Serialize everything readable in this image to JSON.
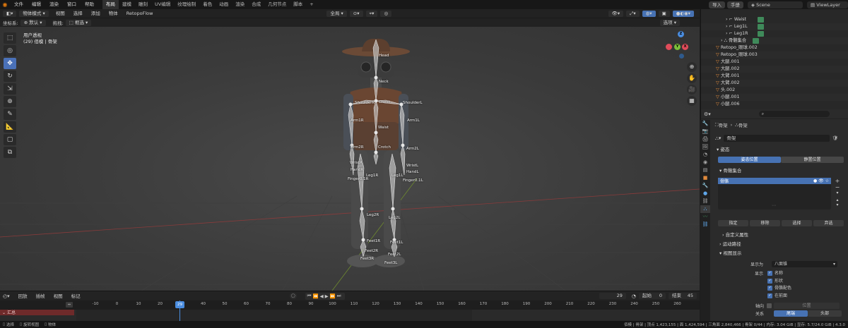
{
  "topbar": {
    "menus": [
      "文件",
      "编辑",
      "渲染",
      "窗口",
      "帮助"
    ],
    "workspaces": [
      "布局",
      "建模",
      "雕刻",
      "UV编辑",
      "纹理绘制",
      "着色",
      "动画",
      "渲染",
      "合成",
      "几何节点",
      "脚本"
    ],
    "active_workspace": "布局",
    "add_tab": "+",
    "import_label": "导入",
    "export_label": "手册",
    "scene_label": "Scene",
    "view_layer_label": "ViewLayer"
  },
  "header1": {
    "mode": "物体模式",
    "menus": [
      "视图",
      "选择",
      "添加",
      "物体",
      "RetopoFlow"
    ],
    "transform": "全局",
    "select_label": "选项"
  },
  "header2": {
    "coord_label": "坐标系:",
    "coord_value": "默认",
    "drag_label": "拖拽:",
    "drag_value": "框选"
  },
  "viewport": {
    "view_name": "用户透视",
    "object_info": "(29) 佰模 | 骨架",
    "bone_labels": [
      {
        "text": "Head"
      },
      {
        "text": "Neck"
      },
      {
        "text": "ShoulderR"
      },
      {
        "text": "Chest"
      },
      {
        "text": "ShoulderL"
      },
      {
        "text": "Arm1R"
      },
      {
        "text": "Waist"
      },
      {
        "text": "Arm1L"
      },
      {
        "text": "Arm2R"
      },
      {
        "text": "Crotch"
      },
      {
        "text": "Arm2L"
      },
      {
        "text": "WristR"
      },
      {
        "text": "WristL"
      },
      {
        "text": "HandR"
      },
      {
        "text": "HandL"
      },
      {
        "text": "Leg1R"
      },
      {
        "text": "Leg1L"
      },
      {
        "text": "Finger0.1R"
      },
      {
        "text": "Finger0.1L"
      },
      {
        "text": "Leg2R"
      },
      {
        "text": "Leg2L"
      },
      {
        "text": "Feet1R"
      },
      {
        "text": "Feet1L"
      },
      {
        "text": "Feet2R"
      },
      {
        "text": "Feet2L"
      },
      {
        "text": "Feet3R"
      },
      {
        "text": "Feet3L"
      }
    ],
    "gizmo": {
      "x": "X",
      "y": "Y",
      "z": "Z"
    }
  },
  "outliner": {
    "items": [
      {
        "label": "Waist",
        "type": "bone",
        "indent": 5
      },
      {
        "label": "Leg1L",
        "type": "bone",
        "indent": 5
      },
      {
        "label": "Leg1R",
        "type": "bone",
        "indent": 5
      },
      {
        "label": "骨骼集合",
        "type": "collection",
        "indent": 4
      },
      {
        "label": "Retopo_眼球.002",
        "type": "mesh",
        "indent": 3
      },
      {
        "label": "Retopo_眼球.003",
        "type": "mesh",
        "indent": 3
      },
      {
        "label": "大腿.001",
        "type": "mesh",
        "indent": 3
      },
      {
        "label": "大腿.002",
        "type": "mesh",
        "indent": 3
      },
      {
        "label": "大臂.001",
        "type": "mesh",
        "indent": 3
      },
      {
        "label": "大臂.002",
        "type": "mesh",
        "indent": 3
      },
      {
        "label": "头.002",
        "type": "mesh",
        "indent": 3
      },
      {
        "label": "小腿.001",
        "type": "mesh",
        "indent": 3
      },
      {
        "label": "小腿.006",
        "type": "mesh",
        "indent": 3
      }
    ]
  },
  "properties": {
    "breadcrumb_obj": "骨架",
    "breadcrumb_data": "骨架",
    "data_name": "骨架",
    "pose_panel": "姿态",
    "pose_position": "姿态位置",
    "rest_position": "静置位置",
    "bone_collections_panel": "骨骼集合",
    "collection_item": "骨骼",
    "assign": "指定",
    "remove": "移除",
    "select": "选择",
    "deselect": "弃选",
    "custom_props": "自定义属性",
    "motion_paths": "运动路径",
    "viewport_display": "视图显示",
    "display_as_label": "显示为",
    "display_as_value": "八面锥",
    "show_label": "显示",
    "show_names": "名称",
    "show_shapes": "形状",
    "show_colors": "骨骼配色",
    "show_infront": "在前面",
    "axes_label": "轴向",
    "axes_value": "位置",
    "relations_label": "关系",
    "relations_a": "尾端",
    "relations_b": "头部"
  },
  "timeline": {
    "menus": [
      "回放",
      "插帧",
      "视图",
      "标记"
    ],
    "current_frame": "29",
    "start_label": "起始",
    "start_value": "0",
    "end_label": "结束",
    "end_value": "45",
    "ruler": [
      "-10",
      "0",
      "10",
      "20",
      "29",
      "40",
      "50",
      "60",
      "70",
      "80",
      "90",
      "100",
      "110",
      "120",
      "130",
      "140",
      "150",
      "160",
      "170",
      "180",
      "190",
      "200",
      "210",
      "220",
      "230",
      "240",
      "250",
      "260"
    ],
    "track_label": "汇总"
  },
  "statusbar": {
    "select": "选择",
    "rotate": "旋转视图",
    "object": "物体",
    "stats": "佰模 | 骨架 | 顶点 1,423,155 | 面 1,424,594 | 三角面 2,840,466 | 骨架 0/44 | 内存: 3.04 GiB | 显存: 5.7/24.0 GiB | 4.3.0"
  },
  "colors": {
    "accent": "#4772b3",
    "collection_green": "#3f8a5a",
    "mesh_orange": "#e08a3c"
  }
}
